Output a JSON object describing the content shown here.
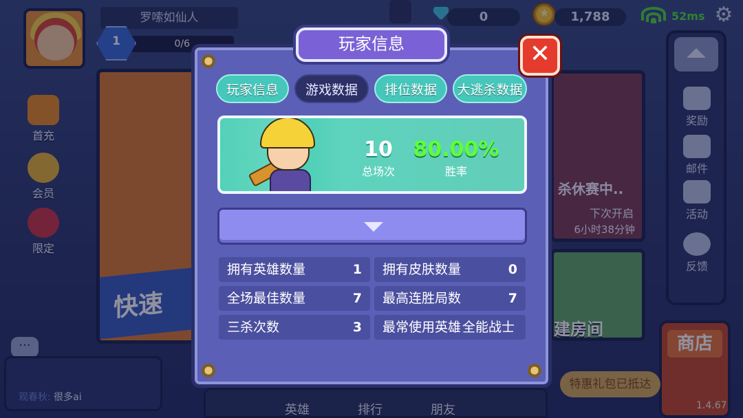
{
  "player": {
    "name": "罗嗦如仙人",
    "level": "1",
    "exp": "0/6"
  },
  "resources": {
    "gems": "0",
    "coins": "1,788",
    "ping": "52ms"
  },
  "left_menu": [
    {
      "label": "首充",
      "icon": "gift-icon"
    },
    {
      "label": "会员",
      "icon": "crown-icon"
    },
    {
      "label": "限定",
      "icon": "shirt-icon"
    }
  ],
  "right_menu": [
    {
      "label": "奖励",
      "icon": "money-bag-icon"
    },
    {
      "label": "邮件",
      "icon": "mail-icon"
    },
    {
      "label": "活动",
      "icon": "flag-icon"
    },
    {
      "label": "反馈",
      "icon": "headset-icon"
    }
  ],
  "background": {
    "quick_match_label": "快速",
    "event_title": "杀休赛中..",
    "next_open_label": "下次开启",
    "countdown": "6小时38分钟",
    "create_room_label": "建房间",
    "shop_label": "商店",
    "gift_tag": "特惠礼包已抵达",
    "version": "1.4.67"
  },
  "chat": {
    "sender": "观春秋:",
    "message": "很多ai",
    "bubble": "···"
  },
  "bottom_nav": [
    {
      "label": "英雄"
    },
    {
      "label": "排行"
    },
    {
      "label": "朋友"
    }
  ],
  "modal": {
    "title": "玩家信息",
    "close": "✕",
    "tabs": [
      {
        "label": "玩家信息",
        "state": "normal"
      },
      {
        "label": "游戏数据",
        "state": "selected"
      },
      {
        "label": "排位数据",
        "state": "normal"
      },
      {
        "label": "大逃杀数据",
        "state": "normal"
      }
    ],
    "summary": {
      "total_matches": "10",
      "total_matches_label": "总场次",
      "win_rate": "80.00%",
      "win_rate_label": "胜率"
    },
    "stats": [
      {
        "label": "拥有英雄数量",
        "value": "1"
      },
      {
        "label": "拥有皮肤数量",
        "value": "0"
      },
      {
        "label": "全场最佳数量",
        "value": "7"
      },
      {
        "label": "最高连胜局数",
        "value": "7"
      },
      {
        "label": "三杀次数",
        "value": "3"
      },
      {
        "label": "最常使用英雄",
        "value": "全能战士"
      }
    ]
  },
  "colors": {
    "tab_normal": "#45c7bb",
    "tab_selected": "#2c3066",
    "win_rate": "#5cff3a",
    "close": "#e43b2e"
  }
}
